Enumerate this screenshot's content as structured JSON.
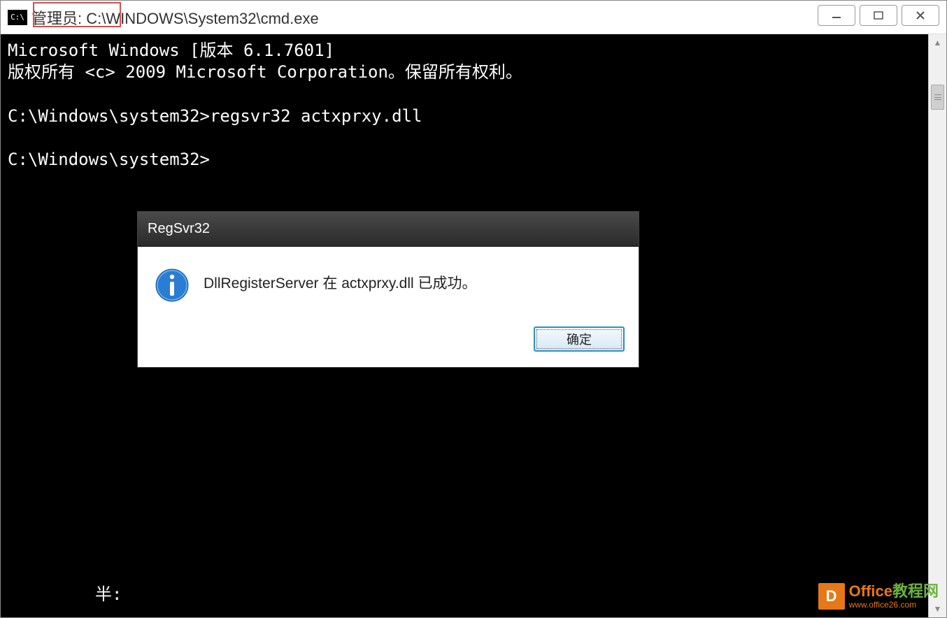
{
  "window": {
    "title": "管理员: C:\\WINDOWS\\System32\\cmd.exe",
    "icon_text": "C:\\"
  },
  "console": {
    "lines": "Microsoft Windows [版本 6.1.7601]\n版权所有 <c> 2009 Microsoft Corporation。保留所有权利。\n\nC:\\Windows\\system32>regsvr32 actxprxy.dll\n\nC:\\Windows\\system32>",
    "bottom_fragment": "半:"
  },
  "dialog": {
    "title": "RegSvr32",
    "message": "DllRegisterServer 在 actxprxy.dll 已成功。",
    "ok_label": "确定"
  },
  "watermark": {
    "icon_letter": "D",
    "title_part1": "Office",
    "title_part2": "教程网",
    "url": "www.office26.com"
  }
}
